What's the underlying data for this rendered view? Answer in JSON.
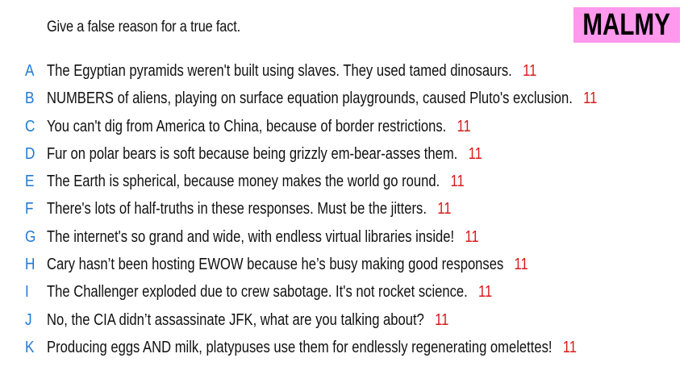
{
  "prompt": "Give a false reason for a true fact.",
  "badge": {
    "label": "MALMY",
    "color": "#ff99ee"
  },
  "colors": {
    "letter": "#1f7ad6",
    "score": "#d81b1b"
  },
  "responses": [
    {
      "letter": "A",
      "text": "The Egyptian pyramids weren't built using slaves. They used tamed dinosaurs.",
      "score": "11"
    },
    {
      "letter": "B",
      "text": "NUMBERS of aliens, playing on surface equation playgrounds, caused Pluto's exclusion.",
      "score": "11"
    },
    {
      "letter": "C",
      "text": "You can't dig from America to China, because of border restrictions.",
      "score": "11"
    },
    {
      "letter": "D",
      "text": "Fur on polar bears is soft because being grizzly em-bear-asses them.",
      "score": "11"
    },
    {
      "letter": "E",
      "text": "The Earth is spherical, because money makes the world go round.",
      "score": "11"
    },
    {
      "letter": "F",
      "text": "There's lots of half-truths in these responses. Must be the jitters.",
      "score": "11"
    },
    {
      "letter": "G",
      "text": "The internet's so grand and wide, with endless virtual libraries inside!",
      "score": "11"
    },
    {
      "letter": "H",
      "text": "Cary hasn’t been hosting EWOW because he’s busy making good responses",
      "score": "11"
    },
    {
      "letter": "I",
      "text": "The Challenger exploded due to crew sabotage. It's not rocket science.",
      "score": "11"
    },
    {
      "letter": "J",
      "text": "No, the CIA didn’t assassinate JFK, what are you talking about?",
      "score": "11"
    },
    {
      "letter": "K",
      "text": "Producing eggs AND milk, platypuses use them for endlessly regenerating omelettes!",
      "score": "11"
    }
  ]
}
